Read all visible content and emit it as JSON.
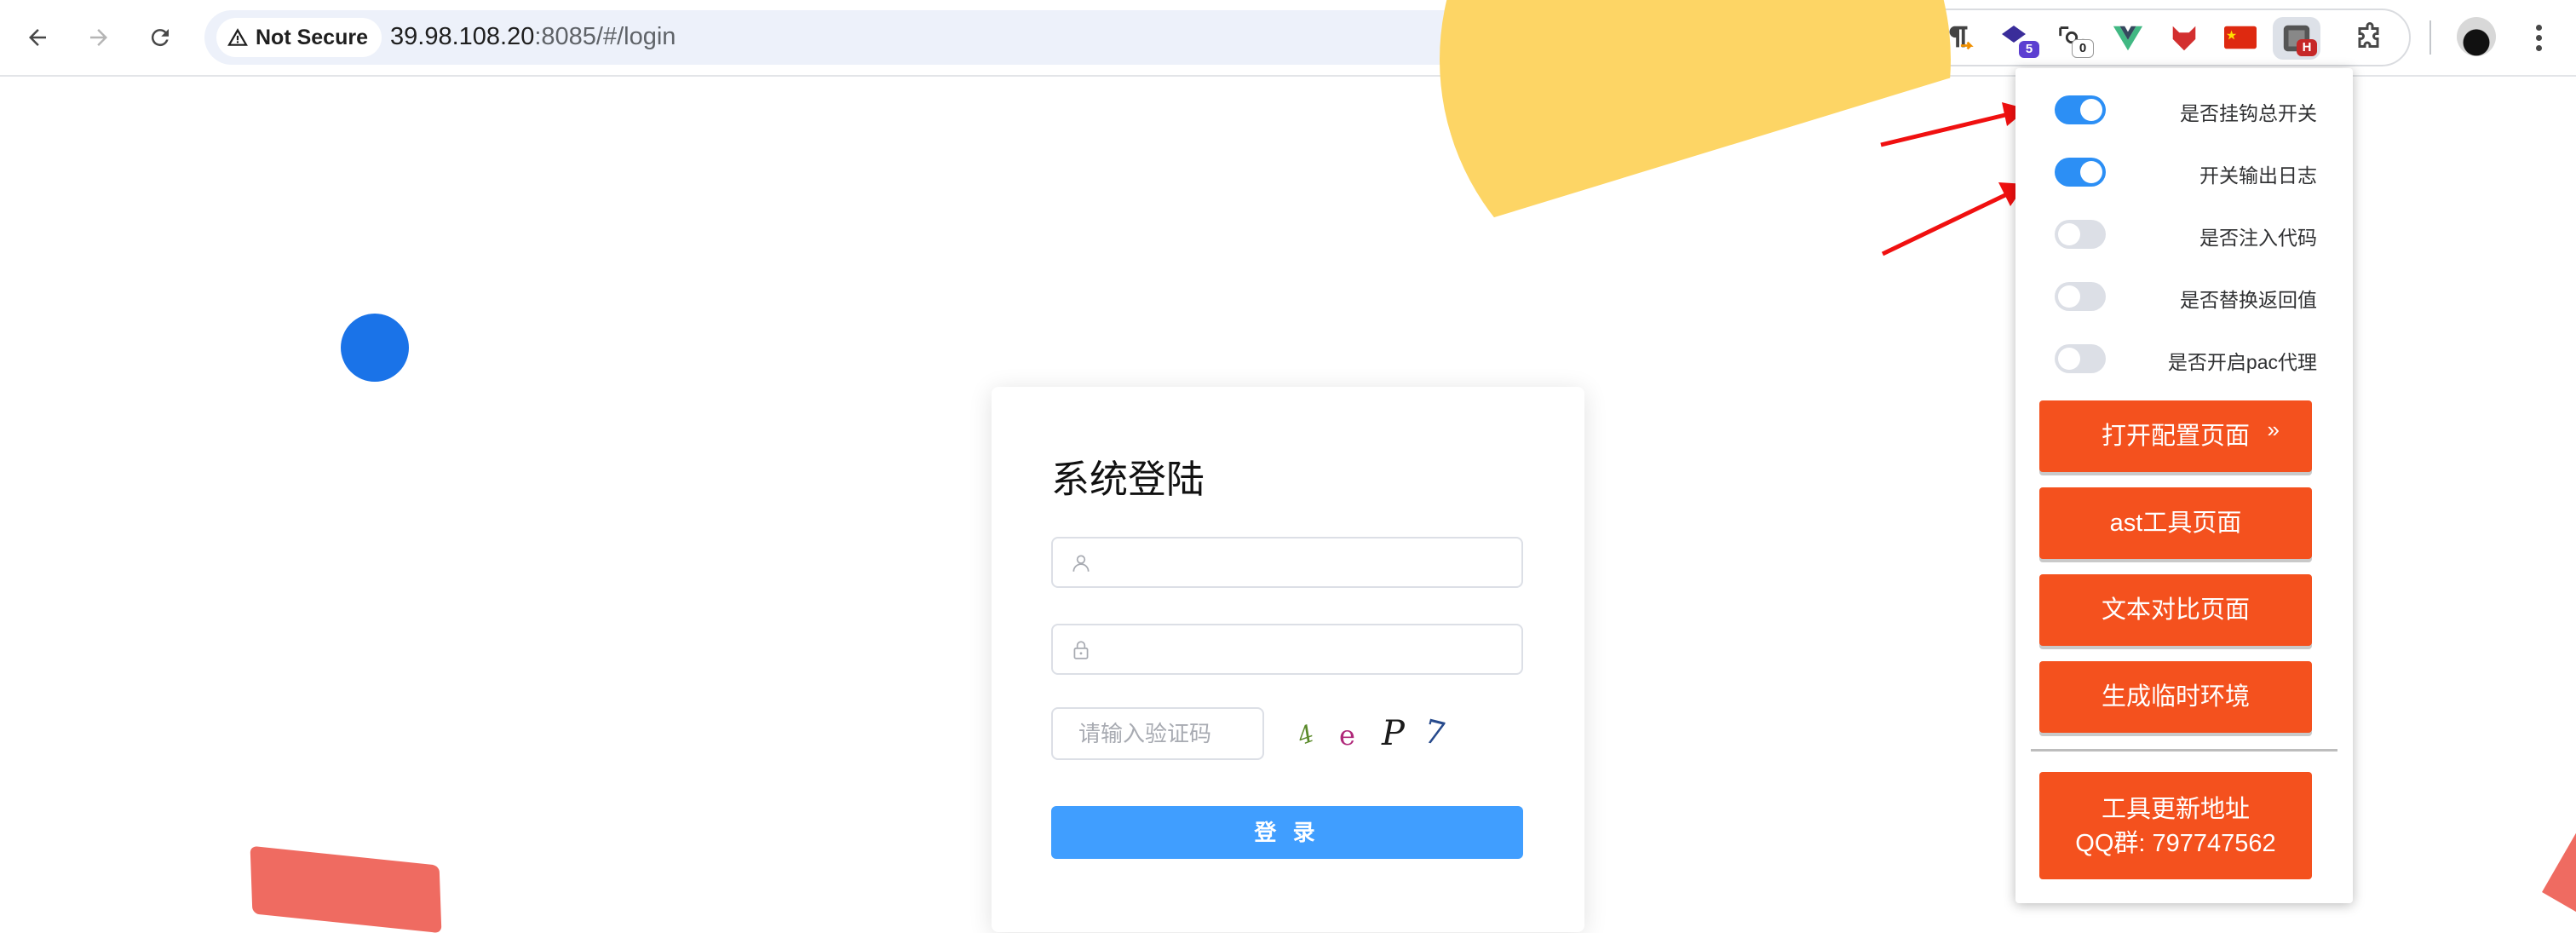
{
  "browser": {
    "security_chip": "Not Secure",
    "url_host": "39.98.108.20",
    "url_path": ":8085/#/login",
    "extensions": [
      {
        "icon": "hook-extension-icon"
      },
      {
        "icon": "paragraph-extension-icon"
      },
      {
        "icon": "stack-extension-icon",
        "badge": "5"
      },
      {
        "icon": "proxy-extension-icon",
        "badge": "0"
      },
      {
        "icon": "vue-devtools-icon"
      },
      {
        "icon": "red-fox-extension-icon"
      },
      {
        "icon": "china-flag-extension-icon"
      },
      {
        "icon": "hook-helper-extension-icon",
        "badge": "H"
      }
    ]
  },
  "login": {
    "title": "系统登陆",
    "captcha_placeholder": "请输入验证码",
    "captcha_chars": [
      "4",
      "e",
      "P",
      "7"
    ],
    "submit_label": "登 录"
  },
  "popup": {
    "switches": [
      {
        "label": "是否挂钩总开关",
        "on": true
      },
      {
        "label": "开关输出日志",
        "on": true
      },
      {
        "label": "是否注入代码",
        "on": false
      },
      {
        "label": "是否替换返回值",
        "on": false
      },
      {
        "label": "是否开启pac代理",
        "on": false
      }
    ],
    "buttons": [
      {
        "label": "打开配置页面",
        "arrow": "»"
      },
      {
        "label": "ast工具页面"
      },
      {
        "label": "文本对比页面"
      },
      {
        "label": "生成临时环境"
      }
    ],
    "update_button": {
      "line1": "工具更新地址",
      "line2": "QQ群: 797747562"
    }
  },
  "colors": {
    "accent_orange": "#f4511e",
    "toggle_on": "#2c8ff5",
    "login_button": "#409eff",
    "deco_yellow": "#fdd565",
    "deco_blue": "#1a73e8",
    "deco_red": "#ef6b61"
  }
}
